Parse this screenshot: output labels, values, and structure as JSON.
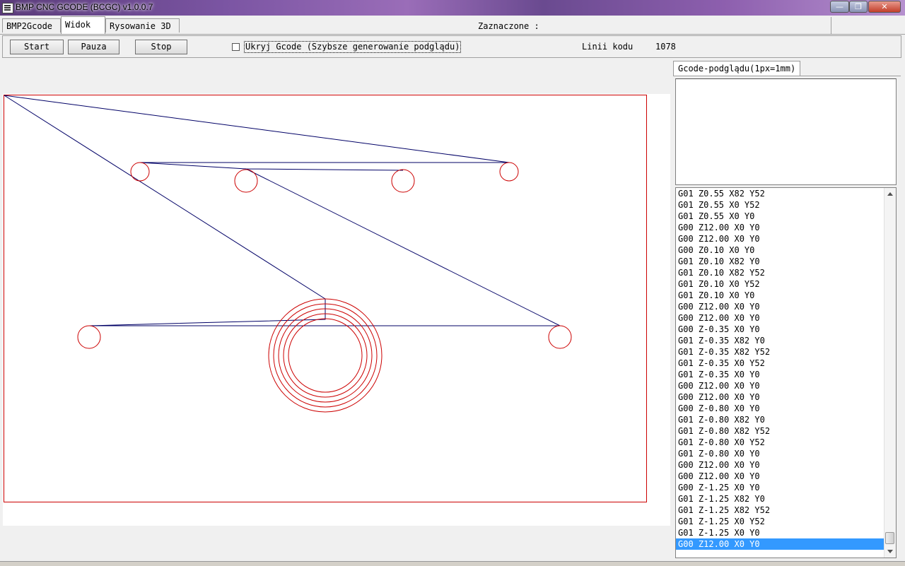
{
  "window": {
    "title": "BMP CNC GCODE (BCGC) v1.0.0.7",
    "min_glyph": "—",
    "max_glyph": "❐",
    "close_glyph": "✕"
  },
  "tabs": [
    {
      "label": "BMP2Gcode",
      "active": false
    },
    {
      "label": "Widok",
      "active": true
    },
    {
      "label": "Rysowanie 3D",
      "active": false
    }
  ],
  "selection_label": "Zaznaczone :",
  "toolbar": {
    "start_label": "Start",
    "pause_label": "Pauza",
    "stop_label": "Stop",
    "hide_gcode_label": "Ukryj Gcode (Szybsze generowanie podglądu)",
    "hide_gcode_checked": false,
    "lines_label": "Linii kodu",
    "lines_value": "1078"
  },
  "drawing": {
    "move_color": "#000066",
    "cut_color": "#cc0000",
    "border_color": "#cc0000"
  },
  "gcode_panel": {
    "tab_label": "Gcode-podglądu(1px=1mm)",
    "lines": [
      "G01 Z0.55 X82 Y52",
      "G01 Z0.55 X0 Y52",
      "G01 Z0.55 X0 Y0",
      "G00 Z12.00 X0 Y0",
      "G00 Z12.00 X0 Y0",
      "G00 Z0.10 X0 Y0",
      "G01 Z0.10 X82 Y0",
      "G01 Z0.10 X82 Y52",
      "G01 Z0.10 X0 Y52",
      "G01 Z0.10 X0 Y0",
      "G00 Z12.00 X0 Y0",
      "G00 Z12.00 X0 Y0",
      "G00 Z-0.35 X0 Y0",
      "G01 Z-0.35 X82 Y0",
      "G01 Z-0.35 X82 Y52",
      "G01 Z-0.35 X0 Y52",
      "G01 Z-0.35 X0 Y0",
      "G00 Z12.00 X0 Y0",
      "G00 Z12.00 X0 Y0",
      "G00 Z-0.80 X0 Y0",
      "G01 Z-0.80 X82 Y0",
      "G01 Z-0.80 X82 Y52",
      "G01 Z-0.80 X0 Y52",
      "G01 Z-0.80 X0 Y0",
      "G00 Z12.00 X0 Y0",
      "G00 Z12.00 X0 Y0",
      "G00 Z-1.25 X0 Y0",
      "G01 Z-1.25 X82 Y0",
      "G01 Z-1.25 X82 Y52",
      "G01 Z-1.25 X0 Y52",
      "G01 Z-1.25 X0 Y0",
      "G00 Z12.00 X0 Y0"
    ],
    "selected_index": 31
  }
}
